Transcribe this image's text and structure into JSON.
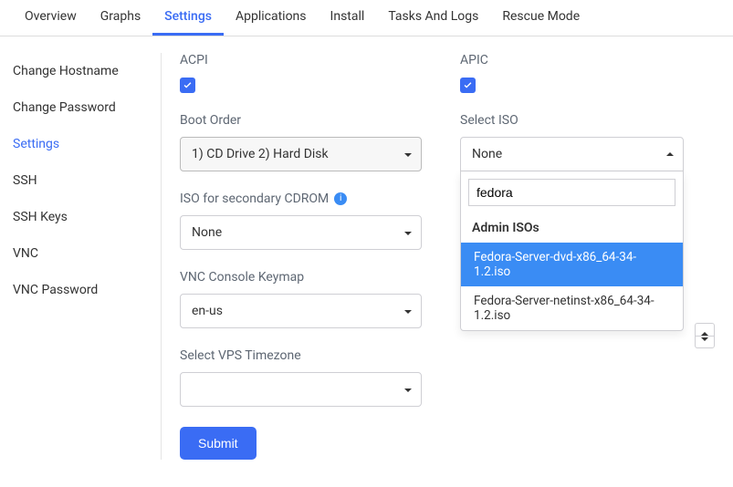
{
  "tabs": [
    "Overview",
    "Graphs",
    "Settings",
    "Applications",
    "Install",
    "Tasks And Logs",
    "Rescue Mode"
  ],
  "active_tab": 2,
  "sidebar": {
    "items": [
      "Change Hostname",
      "Change Password",
      "Settings",
      "SSH",
      "SSH Keys",
      "VNC",
      "VNC Password"
    ],
    "active": 2
  },
  "left": {
    "acpi_label": "ACPI",
    "boot_label": "Boot Order",
    "boot_value": "1) CD Drive 2) Hard Disk",
    "iso2_label": "ISO for secondary CDROM",
    "iso2_value": "None",
    "keymap_label": "VNC Console Keymap",
    "keymap_value": "en-us",
    "tz_label": "Select VPS Timezone",
    "tz_value": "",
    "submit": "Submit"
  },
  "right": {
    "apic_label": "APIC",
    "iso_label": "Select ISO",
    "iso_value": "None",
    "search_value": "fedora",
    "group_label": "Admin ISOs",
    "options": [
      "Fedora-Server-dvd-x86_64-34-1.2.iso",
      "Fedora-Server-netinst-x86_64-34-1.2.iso"
    ],
    "highlighted": 0
  }
}
